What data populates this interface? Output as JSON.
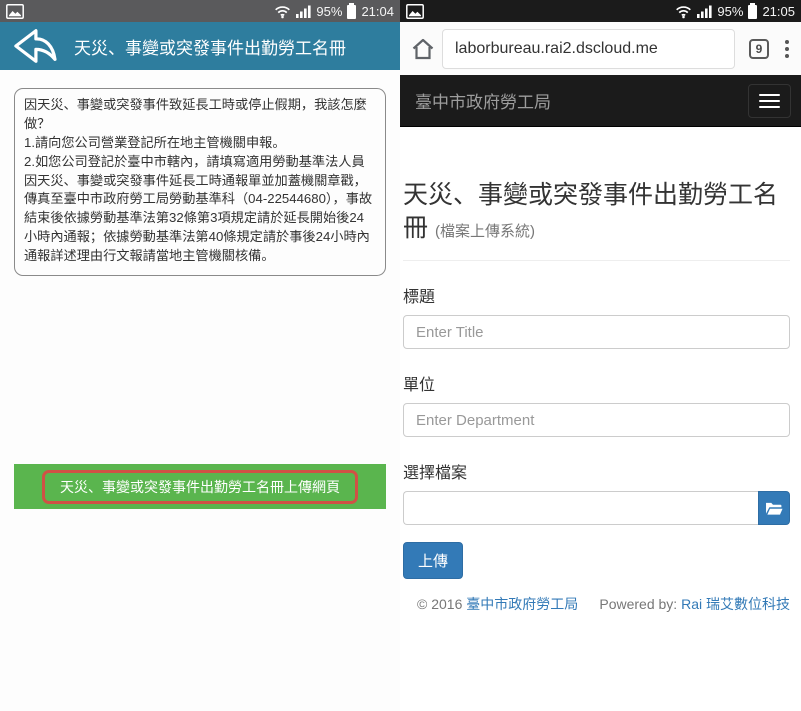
{
  "left": {
    "status": {
      "battery": "95%",
      "time": "21:04"
    },
    "header": {
      "title": "天災、事變或突發事件出勤勞工名冊"
    },
    "notice_text": "因天災、事變或突發事件致延長工時或停止假期，我該怎麼做？\n1.請向您公司營業登記所在地主管機關申報。\n2.如您公司登記於臺中市轄內，請填寫適用勞動基準法人員因天災、事變或突發事件延長工時通報單並加蓋機關章戳，傳真至臺中市政府勞工局勞動基準科（04-22544680），事故結束後依據勞動基準法第32條第3項規定請於延長開始後24小時內通報；依據勞動基準法第40條規定請於事後24小時內通報詳述理由行文報請當地主管機關核備。",
    "upload_link_label": "天災、事變或突發事件出勤勞工名冊上傳網頁"
  },
  "right": {
    "status": {
      "battery": "95%",
      "time": "21:05"
    },
    "browser": {
      "url": "laborbureau.rai2.dscloud.me",
      "tab_count": "9"
    },
    "navbar": {
      "brand": "臺中市政府勞工局"
    },
    "page": {
      "title": "天災、事變或突發事件出勤勞工名冊",
      "subtitle": "(檔案上傳系統)",
      "title_label": "標題",
      "title_placeholder": "Enter Title",
      "department_label": "單位",
      "department_placeholder": "Enter Department",
      "file_label": "選擇檔案",
      "upload_button": "上傳",
      "footer": {
        "copyright_text": "© 2016 ",
        "copyright_link": "臺中市政府勞工局",
        "powered_text": "Powered by: ",
        "powered_link": "Rai 瑞艾數位科技"
      }
    }
  },
  "colors": {
    "app_header_teal": "#2e7d9e",
    "banner_green": "#5ab54e",
    "banner_outline_red": "#d05145",
    "primary_blue": "#337ab7",
    "navbar_bg": "#1b1b1b",
    "statusbar_left": "#5a5a5c",
    "statusbar_right": "#1b1b1b"
  }
}
